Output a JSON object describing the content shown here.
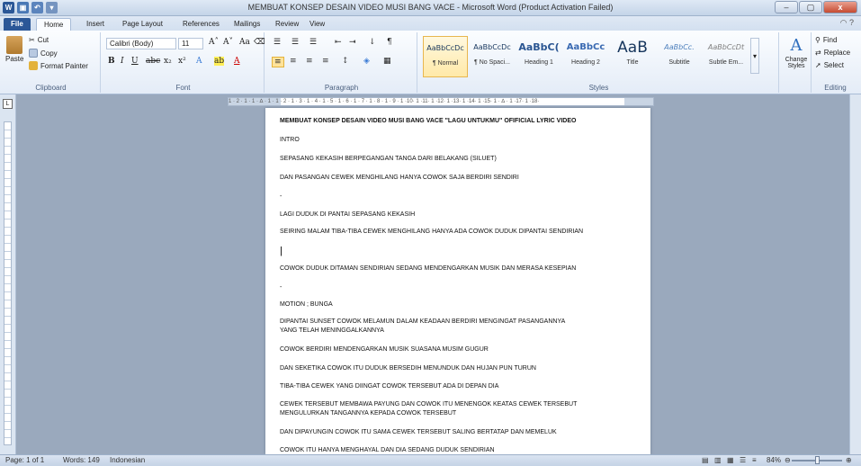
{
  "window": {
    "title": "MEMBUAT KONSEP DESAIN VIDEO MUSI BANG VACE - Microsoft Word (Product Activation Failed)",
    "qat": [
      "W",
      "💾",
      "↶",
      "⌄"
    ],
    "controls": [
      "–",
      "▢",
      "x"
    ]
  },
  "tabs": [
    "File",
    "Home",
    "Insert",
    "Page Layout",
    "References",
    "Mailings",
    "Review",
    "View"
  ],
  "active_tab": "Home",
  "ribbon": {
    "clipboard": {
      "paste": "Paste",
      "cut": "Cut",
      "copy": "Copy",
      "format_painter": "Format Painter",
      "label": "Clipboard"
    },
    "font": {
      "name": "Calibri (Body)",
      "size": "11",
      "label": "Font"
    },
    "paragraph": {
      "label": "Paragraph"
    },
    "styles": {
      "label": "Styles",
      "items": [
        {
          "sample": "AaBbCcDc",
          "name": "¶ Normal"
        },
        {
          "sample": "AaBbCcDc",
          "name": "¶ No Spaci..."
        },
        {
          "sample": "AaBbC(",
          "name": "Heading 1"
        },
        {
          "sample": "AaBbCc",
          "name": "Heading 2"
        },
        {
          "sample": "AaB",
          "name": "Title"
        },
        {
          "sample": "AaBbCc.",
          "name": "Subtitle"
        },
        {
          "sample": "AaBbCcDt",
          "name": "Subtle Em..."
        }
      ],
      "change_styles": "Change Styles"
    },
    "editing": {
      "label": "Editing",
      "find": "Find",
      "replace": "Replace",
      "select": "Select"
    }
  },
  "ruler": "1 · 2 · 1 · 1 · ∆ · 1 · 1 · 2 · 1 · 3 · 1 · 4 · 1 · 5 · 1 · 6 · 1 · 7 · 1 · 8 · 1 · 9 · 1 ·10· 1 ·11· 1 ·12· 1 ·13· 1 ·14· 1 ·15· 1 · ∆ · 1 ·17· 1 ·18·",
  "document": {
    "paragraphs": [
      "MEMBUAT KONSEP DESAIN VIDEO MUSI BANG VACE \"LAGU UNTUKMU\" OFIFICIAL LYRIC VIDEO",
      "INTRO",
      "SEPASANG KEKASIH BERPEGANGAN  TANGA  DARI BELAKANG (SILUET)",
      "DAN PASANGAN CEWEK MENGHILANG HANYA COWOK SAJA BERDIRI SENDIRI",
      "-",
      "LAGI DUDUK DI PANTAI SEPASANG KEKASIH",
      "SEIRING MALAM TIBA-TIBA CEWEK MENGHILANG HANYA ADA COWOK DUDUK DIPANTAI SENDIRIAN",
      "|",
      "COWOK DUDUK DITAMAN SENDIRIAN SEDANG MENDENGARKAN MUSIK DAN MERASA KESEPIAN",
      "-",
      "MOTION ; BUNGA",
      "DIPANTAI SUNSET COWOK MELAMUN DALAM KEADAAN BERDIRI MENGINGAT PASANGANNYA",
      "YANG TELAH MENINGGALKANNYA",
      "COWOK BERDIRI MENDENGARKAN MUSIK SUASANA MUSIM GUGUR",
      "DAN SEKETIKA COWOK ITU DUDUK BERSEDIH MENUNDUK  DAN HUJAN PUN TURUN",
      "TIBA-TIBA CEWEK YANG DIINGAT COWOK TERSEBUT ADA DI DEPAN DIA",
      "CEWEK TERSEBUT MEMBAWA PAYUNG DAN COWOK ITU MENENGOK KEATAS CEWEK TERSEBUT",
      "MENGULURKAN TANGANNYA KEPADA COWOK TERSEBUT",
      "DAN DIPAYUNGIN  COWOK ITU SAMA CEWEK TERSEBUT SALING BERTATAP DAN MEMELUK",
      "COWOK ITU HANYA MENGHAYAL DAN DIA SEDANG DUDUK SENDIRIAN"
    ]
  },
  "status": {
    "page": "Page: 1 of 1",
    "words": "Words: 149",
    "language": "Indonesian",
    "zoom": "84%"
  },
  "colors": {
    "file_tab": "#2b5797",
    "title_bar": "#c4d4e8",
    "page": "#ffffff"
  }
}
